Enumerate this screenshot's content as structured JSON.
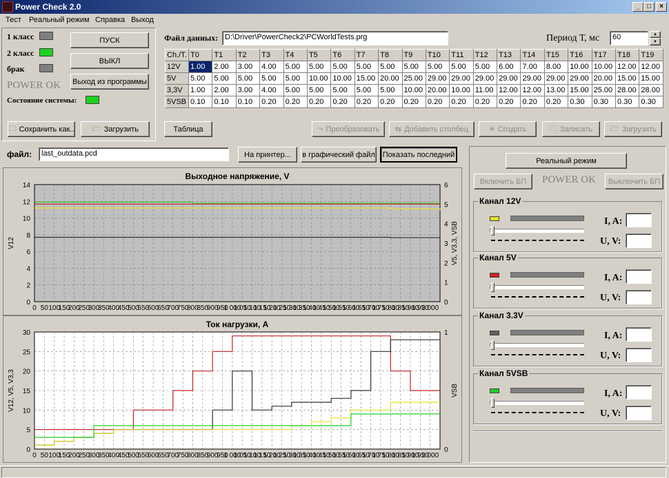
{
  "window": {
    "title": "Power Check 2.0"
  },
  "menu": [
    "Тест",
    "Реальный режим",
    "Справка",
    "Выход"
  ],
  "left_panel": {
    "class1_label": "1 класс",
    "class2_label": "2 класс",
    "reject_label": "брак",
    "power_ok": "POWER OK",
    "system_state_label": "Состояние системы:",
    "start_button": "ПУСК",
    "off_button": "ВЫКЛ",
    "exit_button": "Выход из программы",
    "save_as_button": "Сохранить как..",
    "load_button": "Загрузить",
    "colors": {
      "class1": "#808080",
      "class2": "#1fd11f",
      "reject": "#808080",
      "system": "#1fd11f"
    }
  },
  "data_file": {
    "label": "Файл данных:",
    "value": "D:\\Driver\\PowerCheck2\\PCWorldTests.prg",
    "period_label": "Период Т, мс",
    "period_value": "60"
  },
  "table": {
    "corner": "Ch./T.",
    "columns": [
      "T0",
      "T1",
      "T2",
      "T3",
      "T4",
      "T5",
      "T6",
      "T7",
      "T8",
      "T9",
      "T10",
      "T11",
      "T12",
      "T13",
      "T14",
      "T15",
      "T16",
      "T17",
      "T18",
      "T19"
    ],
    "rows": [
      {
        "ch": "12V",
        "values": [
          "1.00",
          "2.00",
          "3.00",
          "4.00",
          "5.00",
          "5.00",
          "5.00",
          "5.00",
          "5.00",
          "5.00",
          "5.00",
          "5.00",
          "5.00",
          "6.00",
          "7.00",
          "8.00",
          "10.00",
          "10.00",
          "12.00",
          "12.00"
        ]
      },
      {
        "ch": "5V",
        "values": [
          "5.00",
          "5.00",
          "5.00",
          "5.00",
          "5.00",
          "10.00",
          "10.00",
          "15.00",
          "20.00",
          "25.00",
          "29.00",
          "29.00",
          "29.00",
          "29.00",
          "29.00",
          "29.00",
          "29.00",
          "20.00",
          "15.00",
          "15.00"
        ]
      },
      {
        "ch": "3,3V",
        "values": [
          "1.00",
          "2.00",
          "3.00",
          "4.00",
          "5.00",
          "5.00",
          "5.00",
          "5.00",
          "5.00",
          "10.00",
          "20.00",
          "10.00",
          "11.00",
          "12.00",
          "12.00",
          "13.00",
          "15.00",
          "25.00",
          "28.00",
          "28.00"
        ]
      },
      {
        "ch": "5VSB",
        "values": [
          "0.10",
          "0.10",
          "0.10",
          "0.20",
          "0.20",
          "0.20",
          "0.20",
          "0.20",
          "0.20",
          "0.20",
          "0.20",
          "0.20",
          "0.20",
          "0.20",
          "0.20",
          "0.20",
          "0.30",
          "0.30",
          "0.30",
          "0.30"
        ]
      }
    ]
  },
  "table_buttons": {
    "table": "Таблица",
    "convert": "Преобразовать",
    "add_column": "Добавить столбец",
    "create": "Создать",
    "write": "Записать",
    "load": "Загрузить"
  },
  "output": {
    "file_label": "файл:",
    "file_value": "last_outdata.pcd",
    "print_button": "На принтер...",
    "graphic_button": "в графический файл",
    "show_last_button": "Показать последний"
  },
  "right_panel": {
    "real_mode_button": "Реальный режим",
    "enable_psu_button": "Включить БП",
    "power_ok": "POWER OK",
    "disable_psu_button": "Выключить БП",
    "current_label": "I, A:",
    "voltage_label": "U, V:",
    "channels": [
      {
        "name": "Канал 12V",
        "color": "#e8e020",
        "current": "",
        "voltage": ""
      },
      {
        "name": "Канал 5V",
        "color": "#d02020",
        "current": "",
        "voltage": ""
      },
      {
        "name": "Канал 3.3V",
        "color": "#606060",
        "current": "",
        "voltage": ""
      },
      {
        "name": "Канал 5VSB",
        "color": "#20d020",
        "current": "",
        "voltage": ""
      }
    ]
  },
  "chart_data": [
    {
      "type": "line",
      "title": "Выходное напряжение, V",
      "ylabel": "V12",
      "y2label": "V5, V3,3, VSB",
      "xlim": [
        0,
        2050
      ],
      "ylim": [
        0,
        14
      ],
      "y2lim": [
        0,
        6
      ],
      "xticks": [
        "0",
        "50",
        "100",
        "150",
        "200",
        "250",
        "300",
        "350",
        "400",
        "450",
        "500",
        "550",
        "600",
        "650",
        "700",
        "750",
        "800",
        "850",
        "900",
        "950",
        "1 000",
        "1 050",
        "1 100",
        "1 150",
        "1 200",
        "1 250",
        "1 300",
        "1 350",
        "1 400",
        "1 450",
        "1 500",
        "1 550",
        "1 600",
        "1 650",
        "1 700",
        "1 750",
        "1 800",
        "1 850",
        "1 900",
        "1 950",
        "2 000"
      ],
      "yticks": [
        "0",
        "2",
        "4",
        "6",
        "8",
        "10",
        "12",
        "14"
      ],
      "y2ticks": [
        "0",
        "1",
        "2",
        "3",
        "4",
        "5",
        "6"
      ],
      "grid": true,
      "series": [
        {
          "axis": "right",
          "color": "#30d030",
          "x": [
            0,
            400,
            800,
            1200,
            1600,
            2050
          ],
          "values": [
            5.1,
            5.1,
            5.05,
            5.05,
            5.05,
            5.05
          ]
        },
        {
          "axis": "right",
          "color": "#c02020",
          "x": [
            0,
            400,
            800,
            1200,
            1600,
            2050
          ],
          "values": [
            5.0,
            5.0,
            5.0,
            5.0,
            5.0,
            5.0
          ]
        },
        {
          "axis": "right",
          "color": "#e8e020",
          "x": [
            0,
            1200,
            1800,
            2050
          ],
          "values": [
            4.8,
            4.8,
            4.75,
            4.7
          ]
        },
        {
          "axis": "right",
          "color": "#303030",
          "x": [
            0,
            1000,
            1800,
            2050
          ],
          "values": [
            3.3,
            3.3,
            3.28,
            3.25
          ]
        }
      ]
    },
    {
      "type": "line",
      "title": "Ток нагрузки, А",
      "ylabel": "V12, V5, V3,3",
      "y2label": "VSB",
      "xlim": [
        0,
        2050
      ],
      "ylim": [
        0,
        30
      ],
      "y2lim": [
        0,
        1
      ],
      "xticks": [
        "0",
        "50",
        "100",
        "150",
        "200",
        "250",
        "300",
        "350",
        "400",
        "450",
        "500",
        "550",
        "600",
        "650",
        "700",
        "750",
        "800",
        "850",
        "900",
        "950",
        "1 000",
        "1 050",
        "1 100",
        "1 150",
        "1 200",
        "1 250",
        "1 300",
        "1 350",
        "1 400",
        "1 450",
        "1 500",
        "1 550",
        "1 600",
        "1 650",
        "1 700",
        "1 750",
        "1 800",
        "1 850",
        "1 900",
        "1 950",
        "2 000"
      ],
      "yticks": [
        "0",
        "5",
        "10",
        "15",
        "20",
        "25",
        "30"
      ],
      "y2ticks": [
        "0",
        "1"
      ],
      "grid": true,
      "series": [
        {
          "axis": "left",
          "color": "#c02020",
          "x": [
            0,
            100,
            200,
            300,
            400,
            500,
            600,
            700,
            800,
            900,
            1000,
            1100,
            1200,
            1300,
            1400,
            1500,
            1600,
            1700,
            1800,
            1900,
            2000,
            2050
          ],
          "values": [
            5,
            5,
            5,
            5,
            5,
            10,
            10,
            15,
            20,
            25,
            29,
            29,
            29,
            29,
            29,
            29,
            29,
            29,
            20,
            15,
            15,
            15
          ]
        },
        {
          "axis": "left",
          "color": "#303030",
          "x": [
            0,
            100,
            200,
            300,
            400,
            500,
            600,
            700,
            800,
            900,
            1000,
            1100,
            1200,
            1300,
            1400,
            1500,
            1600,
            1700,
            1800,
            1900,
            2000,
            2050
          ],
          "values": [
            1,
            2,
            3,
            4,
            5,
            5,
            5,
            5,
            5,
            10,
            20,
            10,
            11,
            12,
            12,
            13,
            15,
            25,
            28,
            28,
            28,
            28
          ]
        },
        {
          "axis": "left",
          "color": "#e8e020",
          "x": [
            0,
            100,
            200,
            300,
            400,
            500,
            600,
            700,
            800,
            900,
            1000,
            1100,
            1200,
            1300,
            1400,
            1500,
            1600,
            1700,
            1800,
            1900,
            2000,
            2050
          ],
          "values": [
            1,
            2,
            3,
            4,
            5,
            5,
            5,
            5,
            5,
            5,
            5,
            5,
            5,
            6,
            7,
            8,
            10,
            10,
            12,
            12,
            12,
            12
          ]
        },
        {
          "axis": "left",
          "color": "#20d020",
          "x": [
            0,
            100,
            200,
            300,
            400,
            500,
            600,
            700,
            800,
            900,
            1000,
            1100,
            1200,
            1300,
            1400,
            1500,
            1600,
            1700,
            1800,
            1900,
            2000,
            2050
          ],
          "values": [
            3,
            3,
            3,
            6,
            6,
            6,
            6,
            6,
            6,
            6,
            6,
            6,
            6,
            6,
            6,
            6,
            9,
            9,
            9,
            9,
            9,
            9
          ]
        }
      ]
    }
  ]
}
